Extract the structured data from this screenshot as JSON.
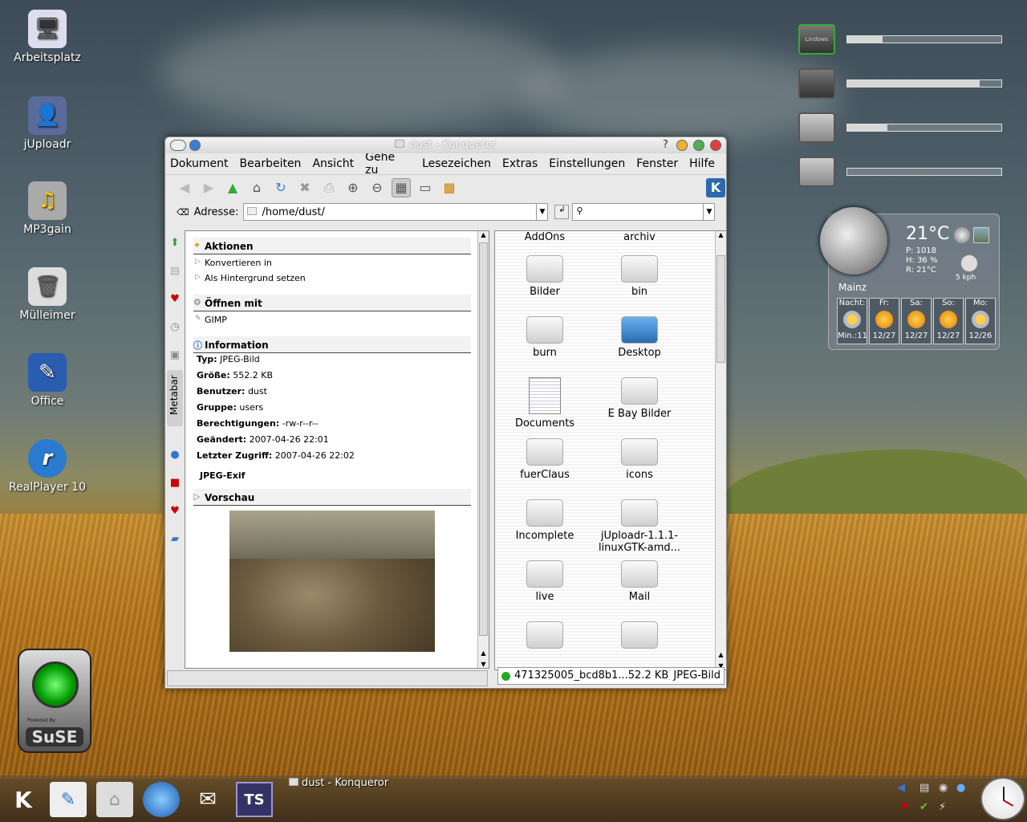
{
  "desktop": {
    "icons": [
      {
        "label": "Arbeitsplatz",
        "glyph": "🖥"
      },
      {
        "label": "jUploadr",
        "glyph": "👤"
      },
      {
        "label": "MP3gain",
        "glyph": "♫"
      },
      {
        "label": "Mülleimer",
        "glyph": "🗑"
      },
      {
        "label": "Office",
        "glyph": "✎"
      },
      {
        "label": "RealPlayer 10",
        "glyph": "r"
      }
    ]
  },
  "monitors": [
    {
      "label": "Lindows",
      "fill": 0.23
    },
    {
      "label": "",
      "fill": 0.86
    },
    {
      "label": "",
      "fill": 0.26
    },
    {
      "label": "",
      "fill": 0.0
    }
  ],
  "weather": {
    "temp": "21°C",
    "pressure": "P: 1018",
    "humidity": "H: 36 %",
    "realfeel": "R: 21°C",
    "wind": "5 kph",
    "city": "Mainz",
    "days": [
      {
        "name": "Nacht:",
        "foot": "Min.:11"
      },
      {
        "name": "Fr:",
        "foot": "12/27"
      },
      {
        "name": "Sa:",
        "foot": "12/27"
      },
      {
        "name": "So:",
        "foot": "12/27"
      },
      {
        "name": "Mo:",
        "foot": "12/26"
      }
    ]
  },
  "suse": {
    "powered": "Powered By",
    "logo": "SuSE"
  },
  "window": {
    "title": "dust - Konqueror",
    "help": "?",
    "menu": [
      "Dokument",
      "Bearbeiten",
      "Ansicht",
      "Gehe zu",
      "Lesezeichen",
      "Extras",
      "Einstellungen",
      "Fenster",
      "Hilfe"
    ],
    "address_label": "Adresse:",
    "address_value": "/home/dust/",
    "metabar_label": "Metabar"
  },
  "metabar": {
    "aktionen": {
      "title": "Aktionen",
      "items": [
        "Konvertieren in",
        "Als Hintergrund setzen"
      ]
    },
    "oeffnen": {
      "title": "Öffnen mit",
      "items": [
        "GIMP"
      ]
    },
    "info": {
      "title": "Information",
      "rows": [
        {
          "k": "Typ:",
          "v": "JPEG-Bild"
        },
        {
          "k": "Größe:",
          "v": "552.2 KB"
        },
        {
          "k": "Benutzer:",
          "v": "dust"
        },
        {
          "k": "Gruppe:",
          "v": "users"
        },
        {
          "k": "Berechtigungen:",
          "v": "-rw-r--r--"
        },
        {
          "k": "Geändert:",
          "v": "2007-04-26 22:01"
        },
        {
          "k": "Letzter Zugriff:",
          "v": "2007-04-26 22:02"
        }
      ],
      "exif": "JPEG-Exif"
    },
    "vorschau": {
      "title": "Vorschau"
    }
  },
  "files": [
    {
      "name": "AddOns",
      "kind": "label-top"
    },
    {
      "name": "archiv",
      "kind": "label-top"
    },
    {
      "name": "Bilder",
      "kind": "folder"
    },
    {
      "name": "bin",
      "kind": "folder"
    },
    {
      "name": "burn",
      "kind": "folder"
    },
    {
      "name": "Desktop",
      "kind": "desktop"
    },
    {
      "name": "Documents",
      "kind": "doc"
    },
    {
      "name": "E Bay Bilder",
      "kind": "folder"
    },
    {
      "name": "fuerClaus",
      "kind": "folder"
    },
    {
      "name": "icons",
      "kind": "folder"
    },
    {
      "name": "Incomplete",
      "kind": "folder"
    },
    {
      "name": "jUploadr-1.1.1-linuxGTK-amd...",
      "kind": "folder"
    },
    {
      "name": "live",
      "kind": "folder"
    },
    {
      "name": "Mail",
      "kind": "folder"
    },
    {
      "name": "",
      "kind": "folder"
    },
    {
      "name": "",
      "kind": "folder"
    }
  ],
  "statusbar": {
    "file": "471325005_bcd8b1...52.2 KB)",
    "type": "JPEG-Bild"
  },
  "taskbar": {
    "task_label": "dust - Konqueror"
  },
  "colors": {
    "accent": "#3b7fd0",
    "close": "#e04040",
    "min": "#f0b030",
    "max": "#50b050"
  }
}
